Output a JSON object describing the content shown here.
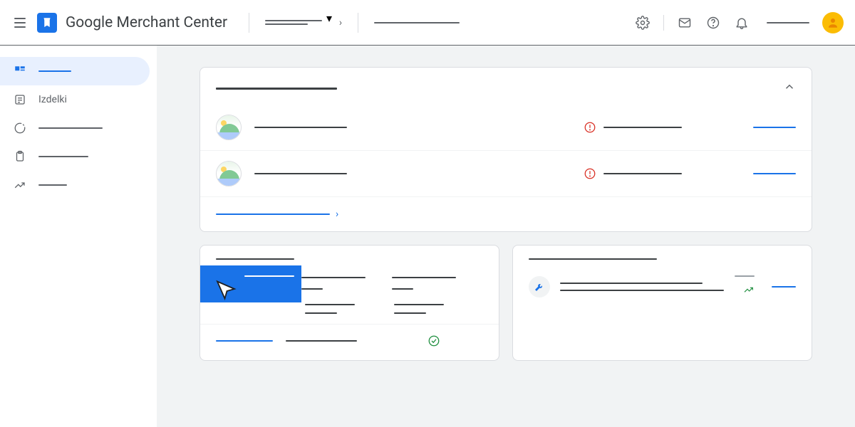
{
  "header": {
    "app_title": "Google Merchant Center",
    "icons": [
      "settings",
      "mail",
      "help",
      "notifications"
    ]
  },
  "sidebar": {
    "items": [
      {
        "id": "overview",
        "icon": "dashboard",
        "active": true,
        "label_width": 46
      },
      {
        "id": "izdelki",
        "icon": "list",
        "label": "Izdelki"
      },
      {
        "id": "performance",
        "icon": "progress",
        "label_width": 90
      },
      {
        "id": "orders",
        "icon": "clipboard",
        "label_width": 70
      },
      {
        "id": "growth",
        "icon": "trend",
        "label_width": 40
      }
    ]
  },
  "card1": {
    "rows": [
      {
        "alert": true
      },
      {
        "alert": true
      }
    ]
  },
  "colors": {
    "primary": "#1a73e8",
    "danger": "#d93025",
    "success": "#1e8e3e",
    "accent_yellow": "#fbbc04"
  }
}
